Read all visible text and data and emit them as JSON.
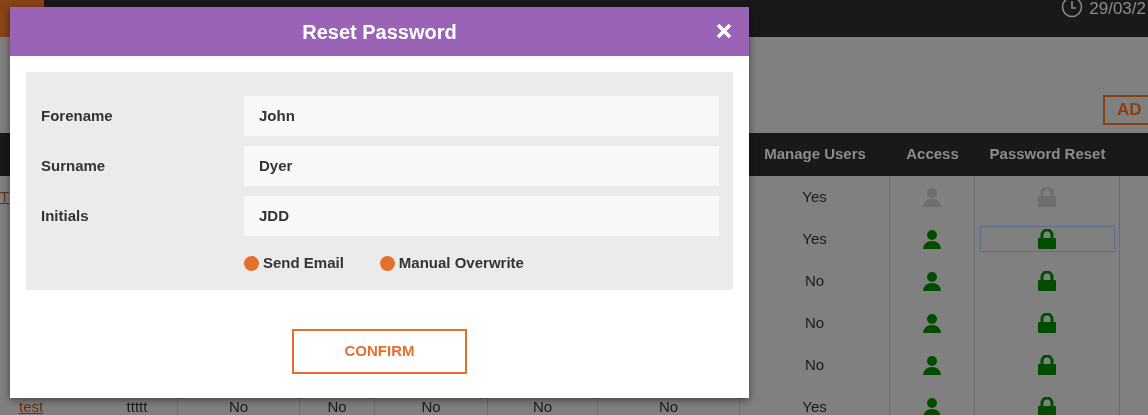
{
  "top_bar": {
    "date": "29/03/2"
  },
  "page": {
    "add_button": "AD"
  },
  "table": {
    "columns": [
      "Manage Users",
      "Access",
      "Password Reset"
    ],
    "rows": [
      {
        "name": "T",
        "cells": [],
        "manage_users": "Yes",
        "access": false,
        "reset_enabled": false,
        "focused": false
      },
      {
        "cells": [],
        "manage_users": "Yes",
        "access": true,
        "reset_enabled": true,
        "focused": true
      },
      {
        "cells": [],
        "manage_users": "No",
        "access": true,
        "reset_enabled": true,
        "focused": false
      },
      {
        "cells": [],
        "manage_users": "No",
        "access": true,
        "reset_enabled": true,
        "focused": false
      },
      {
        "cells": [],
        "manage_users": "No",
        "access": true,
        "reset_enabled": true,
        "focused": false
      },
      {
        "name": "test",
        "cells": [
          "ttttt",
          "No",
          "No",
          "No",
          "No",
          "No"
        ],
        "manage_users": "Yes",
        "access": true,
        "reset_enabled": true,
        "focused": false
      }
    ]
  },
  "dialog": {
    "title": "Reset Password",
    "fields": [
      {
        "label": "Forename",
        "value": "John"
      },
      {
        "label": "Surname",
        "value": "Dyer"
      },
      {
        "label": "Initials",
        "value": "JDD"
      }
    ],
    "options": [
      "Send Email",
      "Manual Overwrite"
    ],
    "confirm_button": "CONFIRM"
  }
}
